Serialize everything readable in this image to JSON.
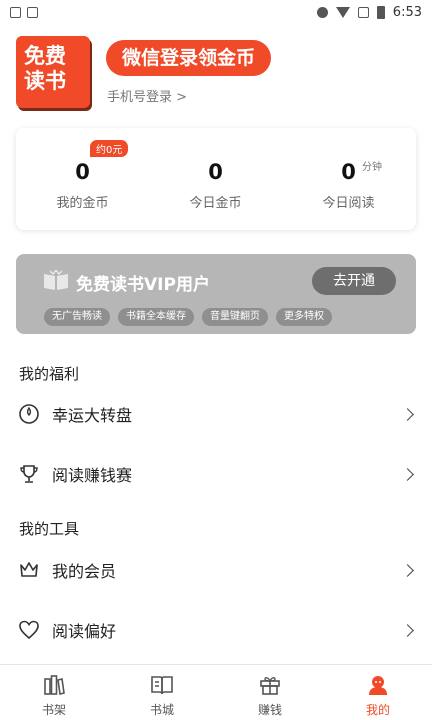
{
  "status_bar": {
    "time": "6:53",
    "icons": [
      "dnd-icon",
      "wifi-icon",
      "no-sim-icon",
      "battery-icon"
    ]
  },
  "profile": {
    "logo_line1": "免费",
    "logo_line2": "读书",
    "login_button": "微信登录领金币",
    "phone_login": "手机号登录 >"
  },
  "stats": {
    "coins_badge": "约0元",
    "items": [
      {
        "value": "0",
        "label": "我的金币"
      },
      {
        "value": "0",
        "label": "今日金币"
      },
      {
        "value": "0",
        "unit": "分钟",
        "label": "今日阅读"
      }
    ]
  },
  "vip": {
    "title": "免费读书VIP用户",
    "open_button": "去开通",
    "features": [
      "无广告畅读",
      "书籍全本缓存",
      "音量键翻页",
      "更多特权"
    ]
  },
  "welfare": {
    "title": "我的福利",
    "items": [
      {
        "label": "幸运大转盘",
        "icon": "wheel-icon"
      },
      {
        "label": "阅读赚钱赛",
        "icon": "trophy-icon"
      }
    ]
  },
  "tools": {
    "title": "我的工具",
    "items": [
      {
        "label": "我的会员",
        "icon": "crown-icon"
      },
      {
        "label": "阅读偏好",
        "icon": "heart-icon"
      }
    ]
  },
  "tabs": [
    {
      "label": "书架",
      "icon": "bookshelf-icon"
    },
    {
      "label": "书城",
      "icon": "book-icon"
    },
    {
      "label": "赚钱",
      "icon": "gift-icon"
    },
    {
      "label": "我的",
      "icon": "user-icon",
      "active": true
    }
  ],
  "colors": {
    "accent": "#f04a29",
    "vip_bg": "#b6b6b6"
  }
}
